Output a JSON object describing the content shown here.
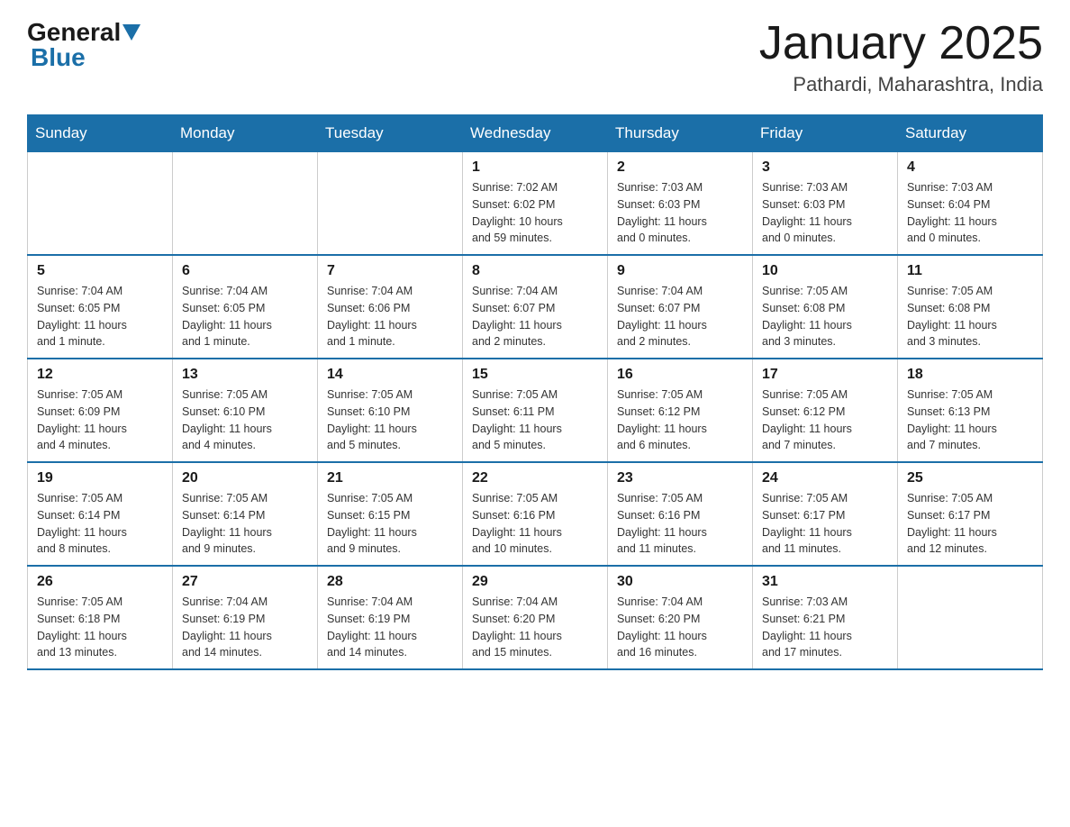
{
  "header": {
    "logo": {
      "text1": "General",
      "text2": "Blue"
    },
    "title": "January 2025",
    "location": "Pathardi, Maharashtra, India"
  },
  "days_of_week": [
    "Sunday",
    "Monday",
    "Tuesday",
    "Wednesday",
    "Thursday",
    "Friday",
    "Saturday"
  ],
  "weeks": [
    [
      {
        "day": "",
        "info": ""
      },
      {
        "day": "",
        "info": ""
      },
      {
        "day": "",
        "info": ""
      },
      {
        "day": "1",
        "info": "Sunrise: 7:02 AM\nSunset: 6:02 PM\nDaylight: 10 hours\nand 59 minutes."
      },
      {
        "day": "2",
        "info": "Sunrise: 7:03 AM\nSunset: 6:03 PM\nDaylight: 11 hours\nand 0 minutes."
      },
      {
        "day": "3",
        "info": "Sunrise: 7:03 AM\nSunset: 6:03 PM\nDaylight: 11 hours\nand 0 minutes."
      },
      {
        "day": "4",
        "info": "Sunrise: 7:03 AM\nSunset: 6:04 PM\nDaylight: 11 hours\nand 0 minutes."
      }
    ],
    [
      {
        "day": "5",
        "info": "Sunrise: 7:04 AM\nSunset: 6:05 PM\nDaylight: 11 hours\nand 1 minute."
      },
      {
        "day": "6",
        "info": "Sunrise: 7:04 AM\nSunset: 6:05 PM\nDaylight: 11 hours\nand 1 minute."
      },
      {
        "day": "7",
        "info": "Sunrise: 7:04 AM\nSunset: 6:06 PM\nDaylight: 11 hours\nand 1 minute."
      },
      {
        "day": "8",
        "info": "Sunrise: 7:04 AM\nSunset: 6:07 PM\nDaylight: 11 hours\nand 2 minutes."
      },
      {
        "day": "9",
        "info": "Sunrise: 7:04 AM\nSunset: 6:07 PM\nDaylight: 11 hours\nand 2 minutes."
      },
      {
        "day": "10",
        "info": "Sunrise: 7:05 AM\nSunset: 6:08 PM\nDaylight: 11 hours\nand 3 minutes."
      },
      {
        "day": "11",
        "info": "Sunrise: 7:05 AM\nSunset: 6:08 PM\nDaylight: 11 hours\nand 3 minutes."
      }
    ],
    [
      {
        "day": "12",
        "info": "Sunrise: 7:05 AM\nSunset: 6:09 PM\nDaylight: 11 hours\nand 4 minutes."
      },
      {
        "day": "13",
        "info": "Sunrise: 7:05 AM\nSunset: 6:10 PM\nDaylight: 11 hours\nand 4 minutes."
      },
      {
        "day": "14",
        "info": "Sunrise: 7:05 AM\nSunset: 6:10 PM\nDaylight: 11 hours\nand 5 minutes."
      },
      {
        "day": "15",
        "info": "Sunrise: 7:05 AM\nSunset: 6:11 PM\nDaylight: 11 hours\nand 5 minutes."
      },
      {
        "day": "16",
        "info": "Sunrise: 7:05 AM\nSunset: 6:12 PM\nDaylight: 11 hours\nand 6 minutes."
      },
      {
        "day": "17",
        "info": "Sunrise: 7:05 AM\nSunset: 6:12 PM\nDaylight: 11 hours\nand 7 minutes."
      },
      {
        "day": "18",
        "info": "Sunrise: 7:05 AM\nSunset: 6:13 PM\nDaylight: 11 hours\nand 7 minutes."
      }
    ],
    [
      {
        "day": "19",
        "info": "Sunrise: 7:05 AM\nSunset: 6:14 PM\nDaylight: 11 hours\nand 8 minutes."
      },
      {
        "day": "20",
        "info": "Sunrise: 7:05 AM\nSunset: 6:14 PM\nDaylight: 11 hours\nand 9 minutes."
      },
      {
        "day": "21",
        "info": "Sunrise: 7:05 AM\nSunset: 6:15 PM\nDaylight: 11 hours\nand 9 minutes."
      },
      {
        "day": "22",
        "info": "Sunrise: 7:05 AM\nSunset: 6:16 PM\nDaylight: 11 hours\nand 10 minutes."
      },
      {
        "day": "23",
        "info": "Sunrise: 7:05 AM\nSunset: 6:16 PM\nDaylight: 11 hours\nand 11 minutes."
      },
      {
        "day": "24",
        "info": "Sunrise: 7:05 AM\nSunset: 6:17 PM\nDaylight: 11 hours\nand 11 minutes."
      },
      {
        "day": "25",
        "info": "Sunrise: 7:05 AM\nSunset: 6:17 PM\nDaylight: 11 hours\nand 12 minutes."
      }
    ],
    [
      {
        "day": "26",
        "info": "Sunrise: 7:05 AM\nSunset: 6:18 PM\nDaylight: 11 hours\nand 13 minutes."
      },
      {
        "day": "27",
        "info": "Sunrise: 7:04 AM\nSunset: 6:19 PM\nDaylight: 11 hours\nand 14 minutes."
      },
      {
        "day": "28",
        "info": "Sunrise: 7:04 AM\nSunset: 6:19 PM\nDaylight: 11 hours\nand 14 minutes."
      },
      {
        "day": "29",
        "info": "Sunrise: 7:04 AM\nSunset: 6:20 PM\nDaylight: 11 hours\nand 15 minutes."
      },
      {
        "day": "30",
        "info": "Sunrise: 7:04 AM\nSunset: 6:20 PM\nDaylight: 11 hours\nand 16 minutes."
      },
      {
        "day": "31",
        "info": "Sunrise: 7:03 AM\nSunset: 6:21 PM\nDaylight: 11 hours\nand 17 minutes."
      },
      {
        "day": "",
        "info": ""
      }
    ]
  ]
}
